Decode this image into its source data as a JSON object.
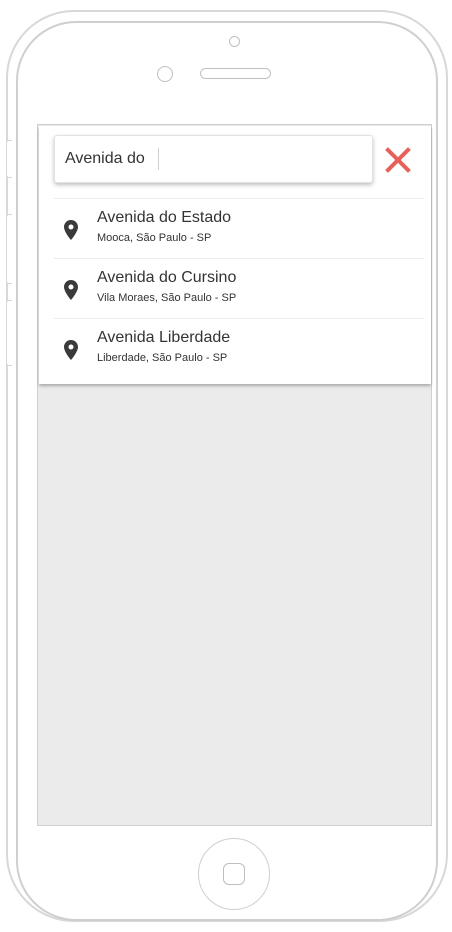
{
  "search": {
    "value": "Avenida do"
  },
  "close_icon": {
    "name": "close-icon",
    "color": "#e8605a"
  },
  "pin_icon": {
    "name": "map-pin-icon",
    "color": "#3a3a3a"
  },
  "results": [
    {
      "title": "Avenida do Estado",
      "subtitle": "Mooca, São Paulo - SP"
    },
    {
      "title": "Avenida do Cursino",
      "subtitle": "Vila Moraes, São Paulo - SP"
    },
    {
      "title": "Avenida Liberdade",
      "subtitle": "Liberdade, São Paulo - SP"
    }
  ],
  "colors": {
    "screen_background": "#ebebeb",
    "panel_background": "#ffffff",
    "text": "#333333"
  }
}
